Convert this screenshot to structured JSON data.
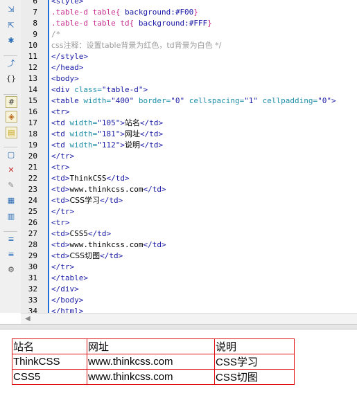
{
  "editor": {
    "lines": [
      {
        "n": "6",
        "segs": [
          {
            "c": "tag",
            "t": "<style>"
          }
        ]
      },
      {
        "n": "7",
        "segs": [
          {
            "c": "sel",
            "t": ".table-d table{ "
          },
          {
            "c": "prop",
            "t": "background:#F00"
          },
          {
            "c": "sel",
            "t": "}"
          }
        ]
      },
      {
        "n": "8",
        "segs": [
          {
            "c": "sel",
            "t": ".table-d table td{ "
          },
          {
            "c": "prop",
            "t": "background:#FFF"
          },
          {
            "c": "sel",
            "t": "}"
          }
        ]
      },
      {
        "n": "9",
        "segs": [
          {
            "c": "com",
            "t": "/*"
          }
        ]
      },
      {
        "n": "10",
        "segs": [
          {
            "c": "com",
            "t": "css注释：设置table背景为红色，td背景为白色 */"
          }
        ]
      },
      {
        "n": "11",
        "segs": [
          {
            "c": "tag",
            "t": "</style>"
          }
        ]
      },
      {
        "n": "12",
        "segs": [
          {
            "c": "tag",
            "t": "</head>"
          }
        ]
      },
      {
        "n": "13",
        "segs": [
          {
            "c": "tag",
            "t": "<body>"
          }
        ]
      },
      {
        "n": "14",
        "segs": [
          {
            "c": "tag",
            "t": "<div "
          },
          {
            "c": "attr",
            "t": "class="
          },
          {
            "c": "val",
            "t": "\"table-d\""
          },
          {
            "c": "tag",
            "t": ">"
          }
        ]
      },
      {
        "n": "15",
        "segs": [
          {
            "c": "tag",
            "t": "<table "
          },
          {
            "c": "attr",
            "t": "width="
          },
          {
            "c": "val",
            "t": "\"400\""
          },
          {
            "c": "attr",
            "t": " border="
          },
          {
            "c": "val",
            "t": "\"0\""
          },
          {
            "c": "attr",
            "t": " cellspacing="
          },
          {
            "c": "val",
            "t": "\"1\""
          },
          {
            "c": "attr",
            "t": " cellpadding="
          },
          {
            "c": "val",
            "t": "\"0\""
          },
          {
            "c": "tag",
            "t": ">"
          }
        ]
      },
      {
        "n": "16",
        "segs": [
          {
            "c": "tag",
            "t": "<tr>"
          }
        ]
      },
      {
        "n": "17",
        "segs": [
          {
            "c": "tag",
            "t": "<td "
          },
          {
            "c": "attr",
            "t": "width="
          },
          {
            "c": "val",
            "t": "\"105\""
          },
          {
            "c": "tag",
            "t": ">"
          },
          {
            "c": "txt",
            "t": "站名"
          },
          {
            "c": "tag",
            "t": "</td>"
          }
        ]
      },
      {
        "n": "18",
        "segs": [
          {
            "c": "tag",
            "t": "<td "
          },
          {
            "c": "attr",
            "t": "width="
          },
          {
            "c": "val",
            "t": "\"181\""
          },
          {
            "c": "tag",
            "t": ">"
          },
          {
            "c": "txt",
            "t": "网址"
          },
          {
            "c": "tag",
            "t": "</td>"
          }
        ]
      },
      {
        "n": "19",
        "segs": [
          {
            "c": "tag",
            "t": "<td "
          },
          {
            "c": "attr",
            "t": "width="
          },
          {
            "c": "val",
            "t": "\"112\""
          },
          {
            "c": "tag",
            "t": ">"
          },
          {
            "c": "txt",
            "t": "说明"
          },
          {
            "c": "tag",
            "t": "</td>"
          }
        ]
      },
      {
        "n": "20",
        "segs": [
          {
            "c": "tag",
            "t": "</tr>"
          }
        ]
      },
      {
        "n": "21",
        "segs": [
          {
            "c": "tag",
            "t": "<tr>"
          }
        ]
      },
      {
        "n": "22",
        "segs": [
          {
            "c": "tag",
            "t": "<td>"
          },
          {
            "c": "txt",
            "t": "ThinkCSS"
          },
          {
            "c": "tag",
            "t": "</td>"
          }
        ]
      },
      {
        "n": "23",
        "segs": [
          {
            "c": "tag",
            "t": "<td>"
          },
          {
            "c": "txt",
            "t": "www.thinkcss.com"
          },
          {
            "c": "tag",
            "t": "</td>"
          }
        ]
      },
      {
        "n": "24",
        "segs": [
          {
            "c": "tag",
            "t": "<td>"
          },
          {
            "c": "txt",
            "t": "CSS学习"
          },
          {
            "c": "tag",
            "t": "</td>"
          }
        ]
      },
      {
        "n": "25",
        "segs": [
          {
            "c": "tag",
            "t": "</tr>"
          }
        ]
      },
      {
        "n": "26",
        "segs": [
          {
            "c": "tag",
            "t": "<tr>"
          }
        ]
      },
      {
        "n": "27",
        "segs": [
          {
            "c": "tag",
            "t": "<td>"
          },
          {
            "c": "txt",
            "t": "CSS5"
          },
          {
            "c": "tag",
            "t": "</td>"
          }
        ]
      },
      {
        "n": "28",
        "segs": [
          {
            "c": "tag",
            "t": "<td>"
          },
          {
            "c": "txt",
            "t": "www.thinkcss.com"
          },
          {
            "c": "tag",
            "t": "</td>"
          }
        ]
      },
      {
        "n": "29",
        "segs": [
          {
            "c": "tag",
            "t": "<td>"
          },
          {
            "c": "txt",
            "t": "CSS切图"
          },
          {
            "c": "tag",
            "t": "</td>"
          }
        ]
      },
      {
        "n": "30",
        "segs": [
          {
            "c": "tag",
            "t": "</tr>"
          }
        ]
      },
      {
        "n": "31",
        "segs": [
          {
            "c": "tag",
            "t": "</table>"
          }
        ]
      },
      {
        "n": "32",
        "segs": [
          {
            "c": "tag",
            "t": "</div>"
          }
        ]
      },
      {
        "n": "33",
        "segs": [
          {
            "c": "tag",
            "t": "</body>"
          }
        ]
      },
      {
        "n": "34",
        "segs": [
          {
            "c": "tag",
            "t": "</html>"
          }
        ]
      }
    ]
  },
  "toolbar_icons": [
    "collapse-tag-icon",
    "collapse-selection-icon",
    "expand-all-icon",
    "select-parent-tag-icon",
    "balance-braces-icon",
    "line-numbers-icon",
    "highlight-invalid-code-icon",
    "syntax-coloring-icon",
    "apply-comment-icon",
    "remove-comment-icon",
    "wrap-tag-icon",
    "recent-snippets-icon",
    "move-css-icon",
    "indent-code-icon",
    "outdent-code-icon",
    "format-source-icon"
  ],
  "preview": {
    "table": [
      [
        "站名",
        "网址",
        "说明"
      ],
      [
        "ThinkCSS",
        "www.thinkcss.com",
        "CSS学习"
      ],
      [
        "CSS5",
        "www.thinkcss.com",
        "CSS切图"
      ]
    ],
    "table_bg": "#F00",
    "cell_bg": "#FFF"
  },
  "colors": {
    "gutter_marker": "#1e6fd9",
    "tag": "#1a1aa6",
    "attr": "#1e8fa8",
    "selector": "#c92f8f",
    "comment": "#9a9a9a"
  }
}
